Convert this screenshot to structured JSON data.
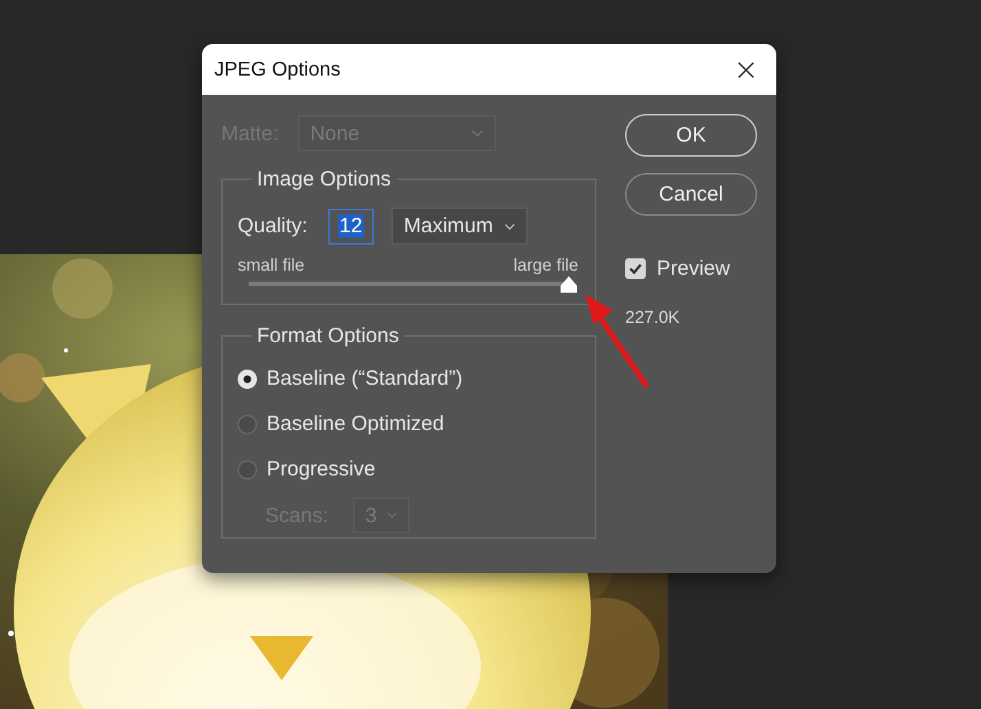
{
  "window": {
    "title": "JPEG Options"
  },
  "matte": {
    "label": "Matte:",
    "value": "None",
    "disabled": true
  },
  "image_options": {
    "title": "Image Options",
    "quality_label": "Quality:",
    "quality_value": "12",
    "quality_value_highlighted": true,
    "quality_preset": "Maximum",
    "slider": {
      "min_label": "small file",
      "max_label": "large file",
      "level": 1.0
    }
  },
  "format_options": {
    "title": "Format Options",
    "choices": [
      {
        "label": "Baseline (“Standard”)",
        "selected": true
      },
      {
        "label": "Baseline Optimized",
        "selected": false
      },
      {
        "label": "Progressive",
        "selected": false
      }
    ],
    "scans": {
      "label": "Scans:",
      "value": "3",
      "disabled": true
    }
  },
  "buttons": [
    {
      "label": "OK"
    },
    {
      "label": "Cancel"
    }
  ],
  "preview": {
    "label": "Preview",
    "checked": true
  },
  "file_size": "227.0K"
}
